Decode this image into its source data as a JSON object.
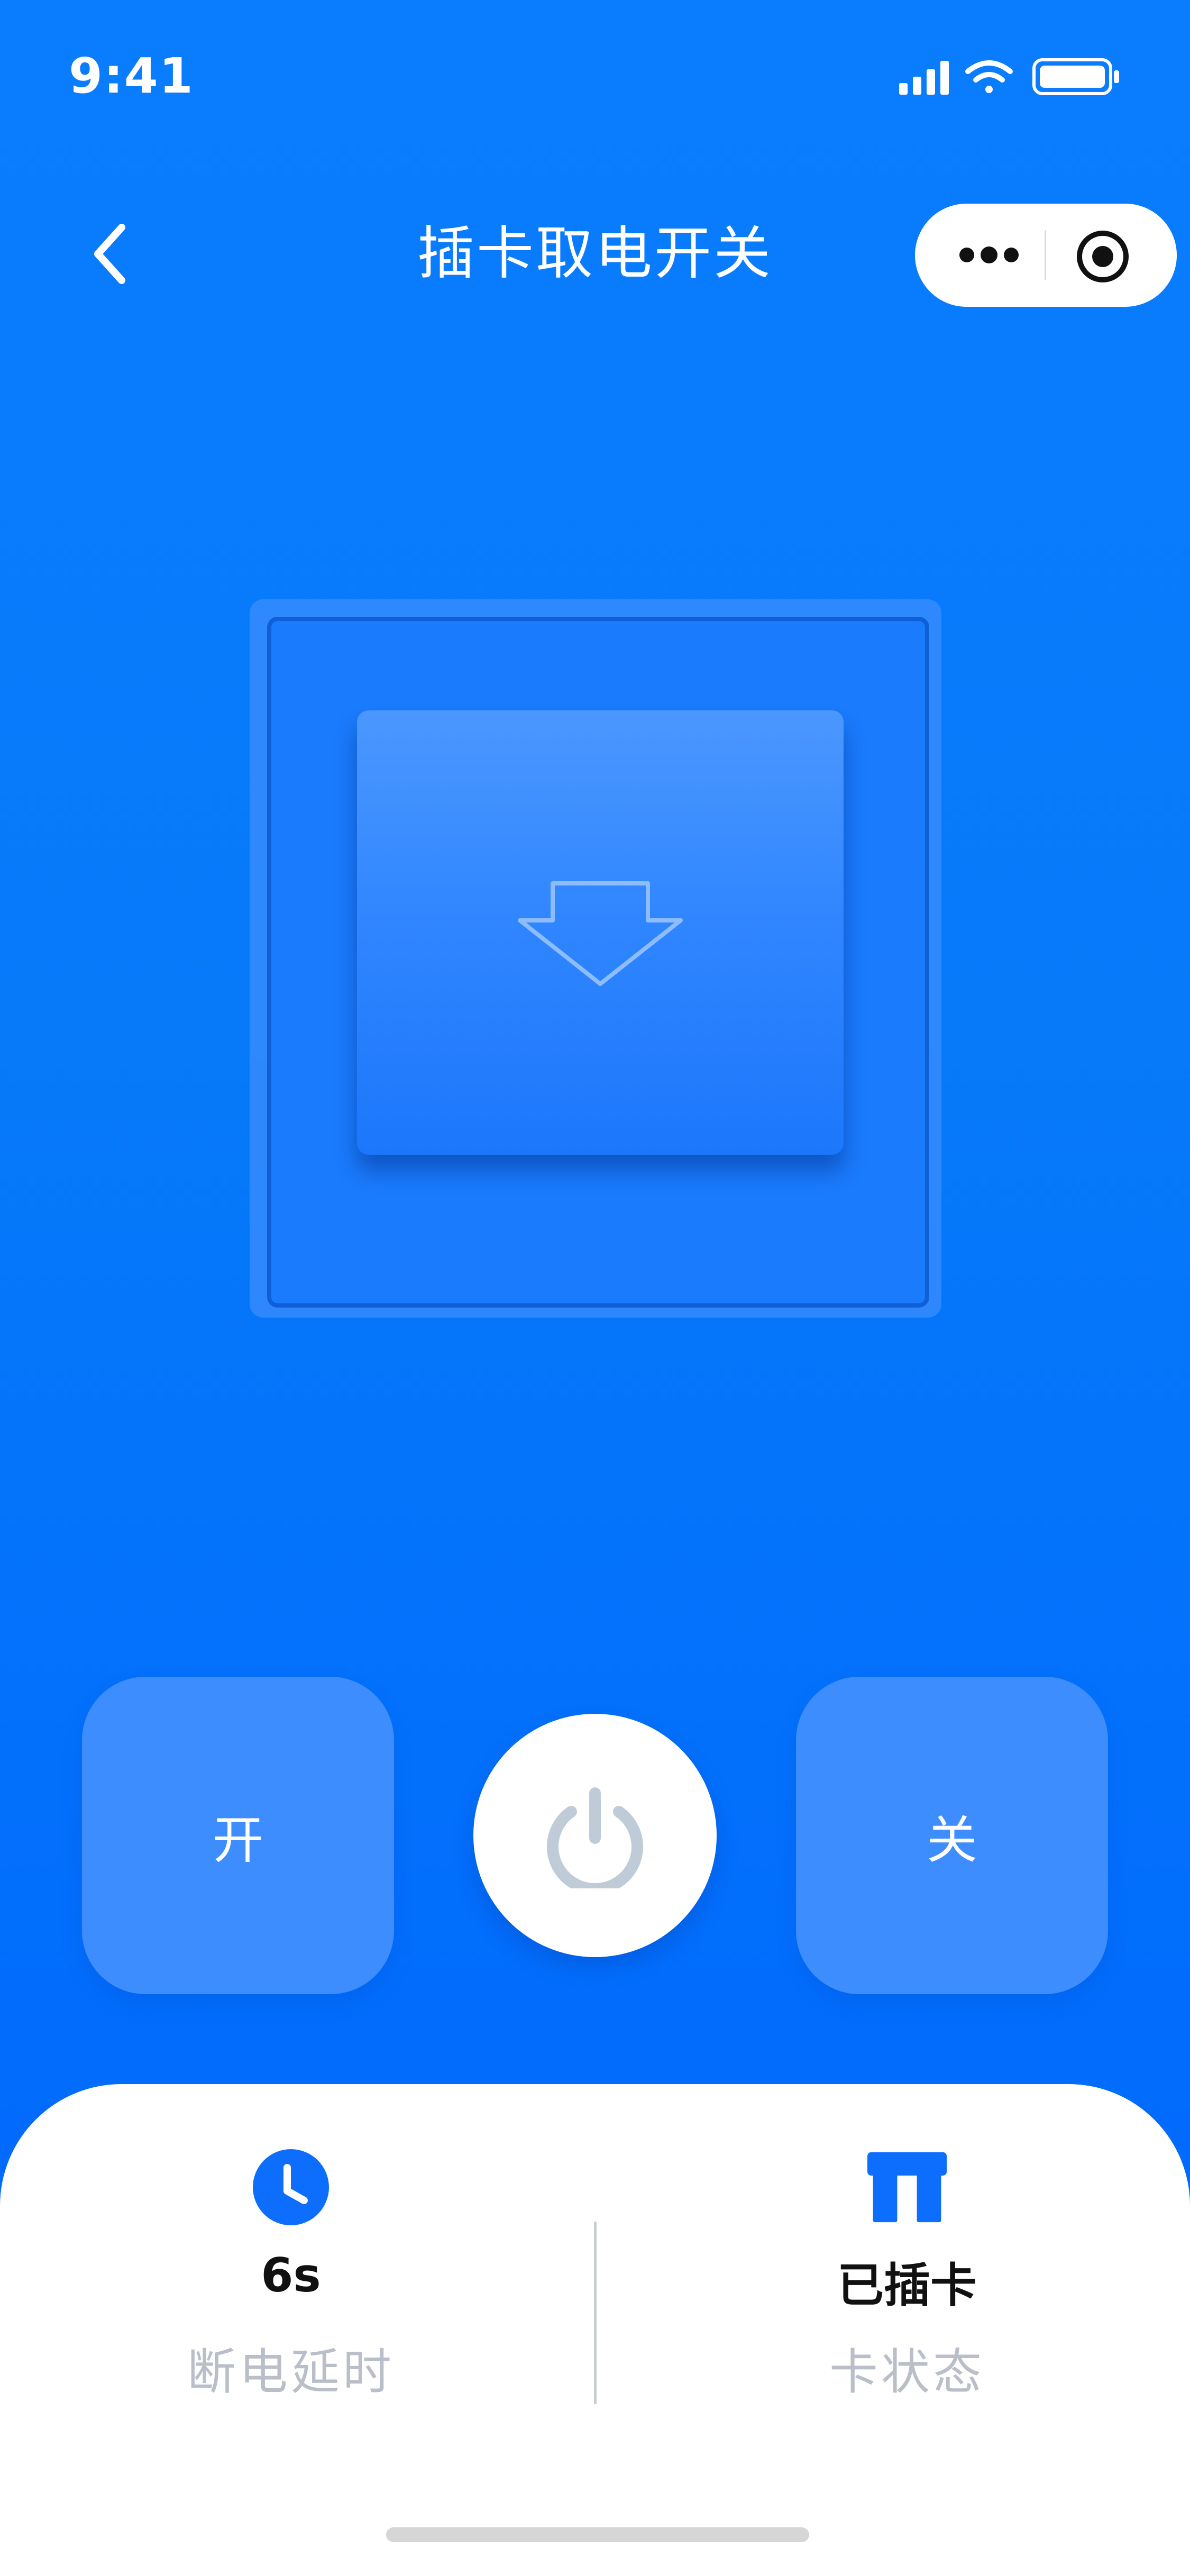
{
  "status_bar": {
    "time": "9:41"
  },
  "nav": {
    "title": "插卡取电开关"
  },
  "icons": {
    "back": "chevron-left-icon",
    "more": "more-dots-icon",
    "close": "target-close-icon",
    "slot_arrow": "arrow-down-outline-icon",
    "power": "power-icon",
    "delay": "clock-icon",
    "card": "card-slot-icon"
  },
  "controls": {
    "on_label": "开",
    "off_label": "关"
  },
  "stats": {
    "delay_value": "6s",
    "delay_label": "断电延时",
    "card_value": "已插卡",
    "card_label": "卡状态"
  },
  "colors": {
    "primary": "#0a7dff",
    "accent_blue": "#0d6efd",
    "panel_bg": "#ffffff",
    "label_gray": "#b9bec8"
  }
}
